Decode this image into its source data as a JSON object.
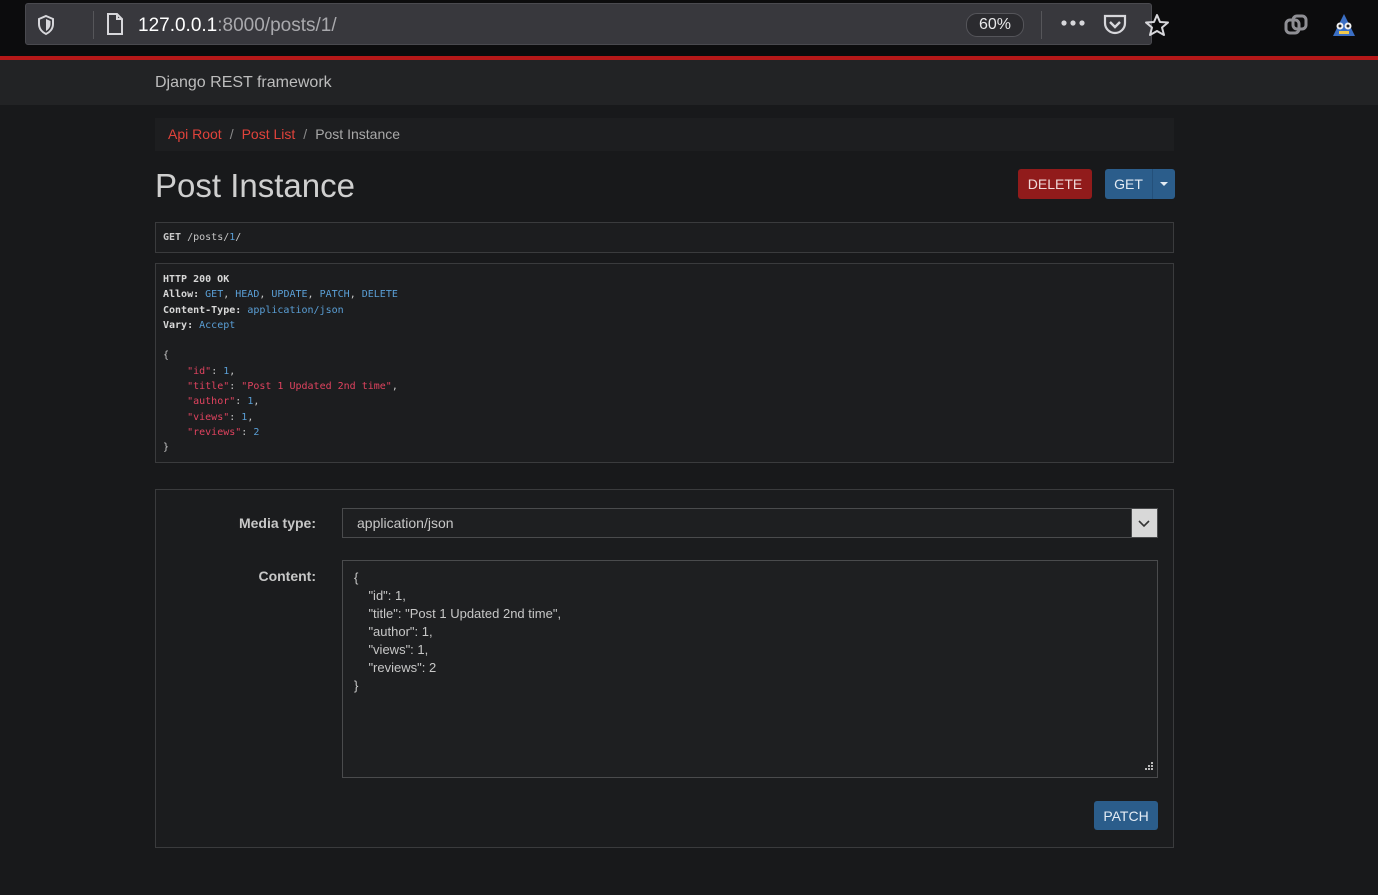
{
  "browser": {
    "url_host": "127.0.0.1",
    "url_rest": ":8000/posts/1/",
    "zoom": "60%"
  },
  "navbar": {
    "brand": "Django REST framework"
  },
  "breadcrumb": {
    "items": [
      "Api Root",
      "Post List"
    ],
    "active": "Post Instance",
    "separator": "/"
  },
  "page": {
    "title": "Post Instance"
  },
  "actions": {
    "delete_label": "DELETE",
    "get_label": "GET"
  },
  "request": {
    "method": "GET",
    "path_prefix": "/posts/",
    "path_id": "1",
    "path_suffix": "/"
  },
  "response": {
    "status": "HTTP 200 OK",
    "allow_label": "Allow:",
    "allow_values": [
      "GET",
      "HEAD",
      "UPDATE",
      "PATCH",
      "DELETE"
    ],
    "content_type_label": "Content-Type:",
    "content_type": "application/json",
    "vary_label": "Vary:",
    "vary": "Accept",
    "open_brace": "{",
    "close_brace": "}",
    "body": [
      {
        "key": "\"id\"",
        "value": "1",
        "kind": "num",
        "comma": ","
      },
      {
        "key": "\"title\"",
        "value": "\"Post 1 Updated 2nd time\"",
        "kind": "str",
        "comma": ","
      },
      {
        "key": "\"author\"",
        "value": "1",
        "kind": "num",
        "comma": ","
      },
      {
        "key": "\"views\"",
        "value": "1",
        "kind": "num",
        "comma": ","
      },
      {
        "key": "\"reviews\"",
        "value": "2",
        "kind": "num",
        "comma": ""
      }
    ]
  },
  "form": {
    "media_type_label": "Media type:",
    "media_type_value": "application/json",
    "content_label": "Content:",
    "content_lines": [
      "{",
      "    \"id\": 1,",
      "    \"title\": \"Post 1 Updated 2nd time\",",
      "    \"author\": 1,",
      "    \"views\": 1,",
      "    \"reviews\": 2",
      "}"
    ],
    "patch_label": "PATCH"
  },
  "colors": {
    "link_red": "#e0433b",
    "delete_bg": "#911b1b",
    "primary_bg": "#2b5d8b",
    "json_key": "#e0435f",
    "json_number": "#5a9fd6",
    "accent_line": "#b51818"
  }
}
